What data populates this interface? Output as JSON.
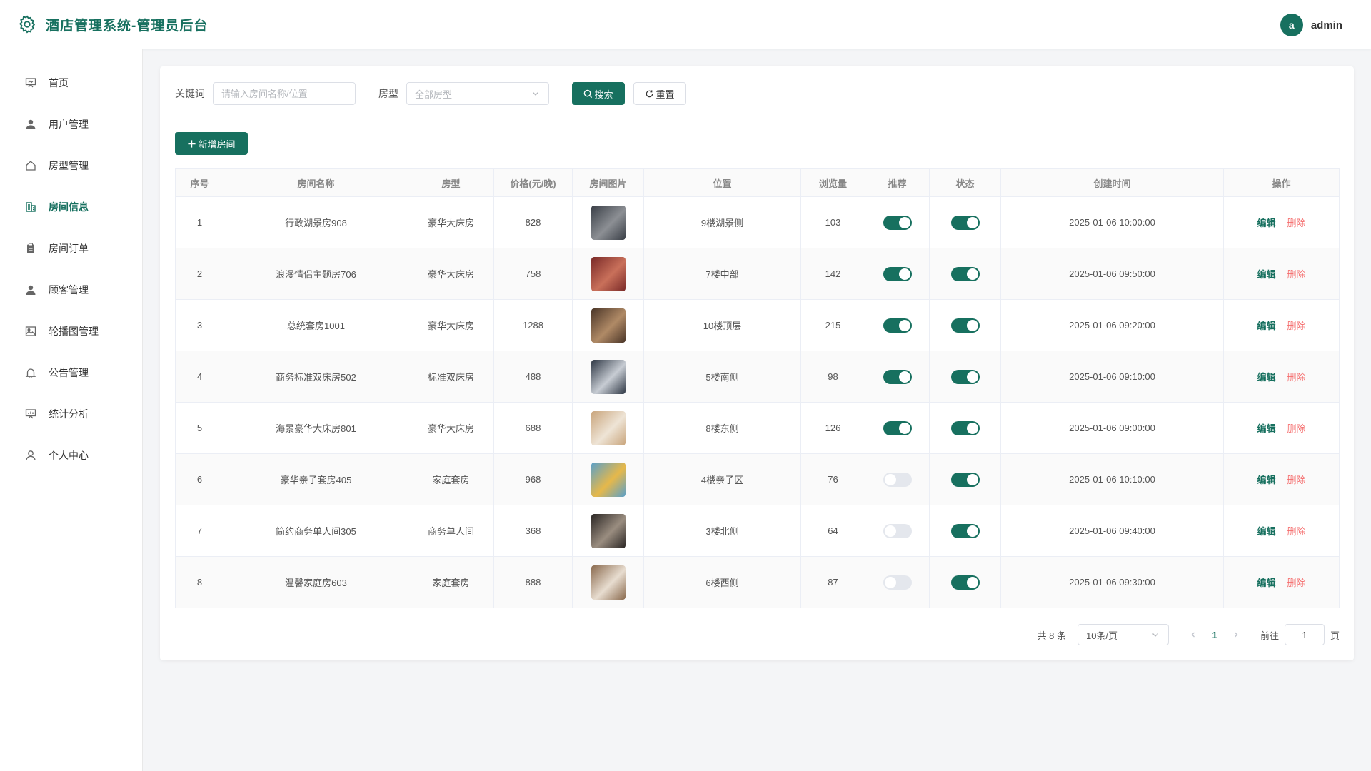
{
  "header": {
    "title": "酒店管理系统-管理员后台",
    "avatar_letter": "a",
    "user_name": "admin",
    "accent": "#17705f"
  },
  "sidebar": {
    "items": [
      {
        "label": "首页",
        "icon": "presentation-icon"
      },
      {
        "label": "用户管理",
        "icon": "user-icon"
      },
      {
        "label": "房型管理",
        "icon": "house-icon"
      },
      {
        "label": "房间信息",
        "icon": "building-icon",
        "active": true
      },
      {
        "label": "房间订单",
        "icon": "clipboard-icon"
      },
      {
        "label": "顾客管理",
        "icon": "user-icon"
      },
      {
        "label": "轮播图管理",
        "icon": "image-icon"
      },
      {
        "label": "公告管理",
        "icon": "bell-icon"
      },
      {
        "label": "统计分析",
        "icon": "chart-icon"
      },
      {
        "label": "个人中心",
        "icon": "person-outline-icon"
      }
    ]
  },
  "filters": {
    "keyword_label": "关键词",
    "keyword_placeholder": "请输入房间名称/位置",
    "keyword_value": "",
    "type_label": "房型",
    "type_placeholder": "全部房型",
    "search_label": "搜索",
    "reset_label": "重置"
  },
  "toolbar": {
    "add_label": "新增房间"
  },
  "table": {
    "columns": [
      "序号",
      "房间名称",
      "房型",
      "价格(元/晚)",
      "房间图片",
      "位置",
      "浏览量",
      "推荐",
      "状态",
      "创建时间",
      "操作"
    ],
    "edit_label": "编辑",
    "delete_label": "删除",
    "rows": [
      {
        "no": "1",
        "name": "行政湖景房908",
        "type": "豪华大床房",
        "price": "828",
        "location": "9楼湖景侧",
        "views": "103",
        "recommend": true,
        "status": true,
        "created": "2025-01-06 10:00:00",
        "thumb": [
          "#3a3f47",
          "#8c8f94"
        ]
      },
      {
        "no": "2",
        "name": "浪漫情侣主题房706",
        "type": "豪华大床房",
        "price": "758",
        "location": "7楼中部",
        "views": "142",
        "recommend": true,
        "status": true,
        "created": "2025-01-06 09:50:00",
        "thumb": [
          "#7a2a28",
          "#c9705a"
        ]
      },
      {
        "no": "3",
        "name": "总统套房1001",
        "type": "豪华大床房",
        "price": "1288",
        "location": "10楼顶层",
        "views": "215",
        "recommend": true,
        "status": true,
        "created": "2025-01-06 09:20:00",
        "thumb": [
          "#4b3628",
          "#b08a66"
        ]
      },
      {
        "no": "4",
        "name": "商务标准双床房502",
        "type": "标准双床房",
        "price": "488",
        "location": "5楼南侧",
        "views": "98",
        "recommend": true,
        "status": true,
        "created": "2025-01-06 09:10:00",
        "thumb": [
          "#2f3845",
          "#c7ccd3"
        ]
      },
      {
        "no": "5",
        "name": "海景豪华大床房801",
        "type": "豪华大床房",
        "price": "688",
        "location": "8楼东侧",
        "views": "126",
        "recommend": true,
        "status": true,
        "created": "2025-01-06 09:00:00",
        "thumb": [
          "#c9a57c",
          "#eee4d6"
        ]
      },
      {
        "no": "6",
        "name": "豪华亲子套房405",
        "type": "家庭套房",
        "price": "968",
        "location": "4楼亲子区",
        "views": "76",
        "recommend": false,
        "status": true,
        "created": "2025-01-06 10:10:00",
        "thumb": [
          "#5aa0c9",
          "#e6b84a"
        ]
      },
      {
        "no": "7",
        "name": "简约商务单人间305",
        "type": "商务单人间",
        "price": "368",
        "location": "3楼北侧",
        "views": "64",
        "recommend": false,
        "status": true,
        "created": "2025-01-06 09:40:00",
        "thumb": [
          "#2a2624",
          "#9a8d80"
        ]
      },
      {
        "no": "8",
        "name": "温馨家庭房603",
        "type": "家庭套房",
        "price": "888",
        "location": "6楼西侧",
        "views": "87",
        "recommend": false,
        "status": true,
        "created": "2025-01-06 09:30:00",
        "thumb": [
          "#8a6a4e",
          "#e8ddd0"
        ]
      }
    ]
  },
  "pagination": {
    "total_text": "共 8 条",
    "page_size": "10条/页",
    "current_page": "1",
    "goto_label": "前往",
    "goto_value": "1",
    "page_suffix": "页"
  }
}
